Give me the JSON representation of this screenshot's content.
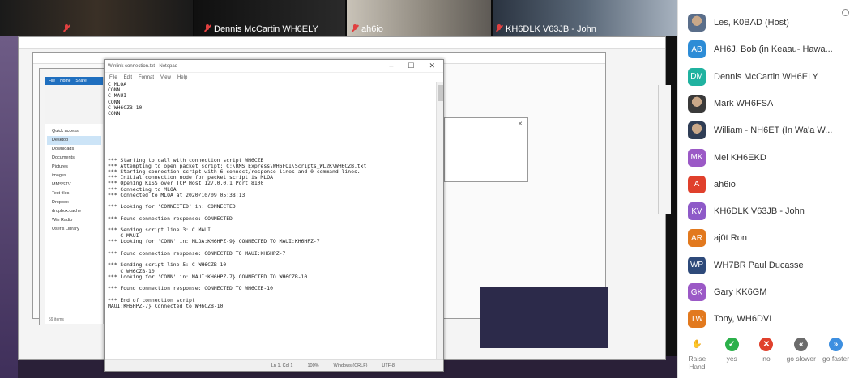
{
  "video_tiles": [
    {
      "name": ""
    },
    {
      "name": "Dennis McCartin WH6ELY"
    },
    {
      "name": "ah6io"
    },
    {
      "name": "KH6DLK V63JB - John"
    }
  ],
  "notepad": {
    "title": "Winlink connection.txt - Notepad",
    "menu": [
      "File",
      "Edit",
      "Format",
      "View",
      "Help"
    ],
    "lines": [
      "C MLOA",
      "CONN",
      "C MAUI",
      "CONN",
      "C WH6CZB-10",
      "CONN",
      "",
      "",
      "",
      "",
      "",
      "",
      "",
      "*** Starting to call with connection script WH6CZB",
      "*** Attempting to open packet script: C:\\RMS Express\\WH6FQI\\Scripts_WL2K\\WH6CZB.txt",
      "*** Starting connection script with 6 connect/response lines and 0 command lines.",
      "*** Initial connection node for packet script is MLOA",
      "*** Opening KISS over TCP Host 127.0.0.1 Port 8100",
      "*** Connecting to MLOA",
      "*** Connected to MLOA at 2020/10/09 05:38:13",
      "",
      "*** Looking for 'CONNECTED' in: CONNECTED",
      "",
      "*** Found connection response: CONNECTED",
      "",
      "*** Sending script line 3: C MAUI",
      "    C MAUI",
      "*** Looking for 'CONN' in: MLOA:KH6HPZ-9} CONNECTED TO MAUI:KH6HPZ-7",
      "",
      "*** Found connection response: CONNECTED TO MAUI:KH6HPZ-7",
      "",
      "*** Sending script line 5: C WH6CZB-10",
      "    C WH6CZB-10",
      "*** Looking for 'CONN' in: MAUI:KH6HPZ-7} CONNECTED TO WH6CZB-10",
      "",
      "*** Found connection response: CONNECTED TO WH6CZB-10",
      "",
      "*** End of connection script",
      "MAUI:KH6HPZ-7} Connected to WH6CZB-10"
    ],
    "status": {
      "position": "Ln 1, Col 1",
      "zoom": "100%",
      "line_ending": "Windows (CRLF)",
      "encoding": "UTF-8"
    }
  },
  "explorer": {
    "tabs": [
      "File",
      "Home",
      "Share"
    ],
    "tree": [
      "Quick access",
      "Desktop",
      "Downloads",
      "Documents",
      "Pictures",
      "images",
      "MMSSTV",
      "Test files",
      "Dropbox",
      "dropbox.cache",
      "Win Radio",
      "User's Library"
    ],
    "status": "59 items"
  },
  "participants": [
    {
      "initials": "",
      "name": "Les, K0BAD (Host)",
      "color": "#5a6e8a",
      "photo": true
    },
    {
      "initials": "AB",
      "name": "AH6J, Bob (in Keaau- Hawa...",
      "color": "#2d8cd6"
    },
    {
      "initials": "DM",
      "name": "Dennis McCartin WH6ELY",
      "color": "#20b2a0"
    },
    {
      "initials": "",
      "name": "Mark WH6FSA",
      "color": "#3a3a3a",
      "photo": true
    },
    {
      "initials": "",
      "name": "William - NH6ET (In Wa'a W...",
      "color": "#2f3d55",
      "photo": true
    },
    {
      "initials": "MK",
      "name": "Mel KH6EKD",
      "color": "#9b59c6"
    },
    {
      "initials": "A",
      "name": "ah6io",
      "color": "#e0402c"
    },
    {
      "initials": "KV",
      "name": "KH6DLK V63JB - John",
      "color": "#8e5ac8"
    },
    {
      "initials": "AR",
      "name": "aj0t Ron",
      "color": "#e2791e"
    },
    {
      "initials": "WP",
      "name": "WH7BR Paul Ducasse",
      "color": "#2e4a7a"
    },
    {
      "initials": "GK",
      "name": "Gary KK6GM",
      "color": "#9b59c6"
    },
    {
      "initials": "TW",
      "name": "Tony, WH6DVI",
      "color": "#e2791e"
    }
  ],
  "reactions": [
    {
      "label": "Raise Hand",
      "icon": "hand-icon",
      "color": "#3d8fe0"
    },
    {
      "label": "yes",
      "icon": "check-icon",
      "color": "#2bb04a"
    },
    {
      "label": "no",
      "icon": "x-icon",
      "color": "#e0402c"
    },
    {
      "label": "go slower",
      "icon": "rewind-icon",
      "color": "#6b6b6b"
    },
    {
      "label": "go faster",
      "icon": "fast-forward-icon",
      "color": "#3d8fe0"
    }
  ]
}
